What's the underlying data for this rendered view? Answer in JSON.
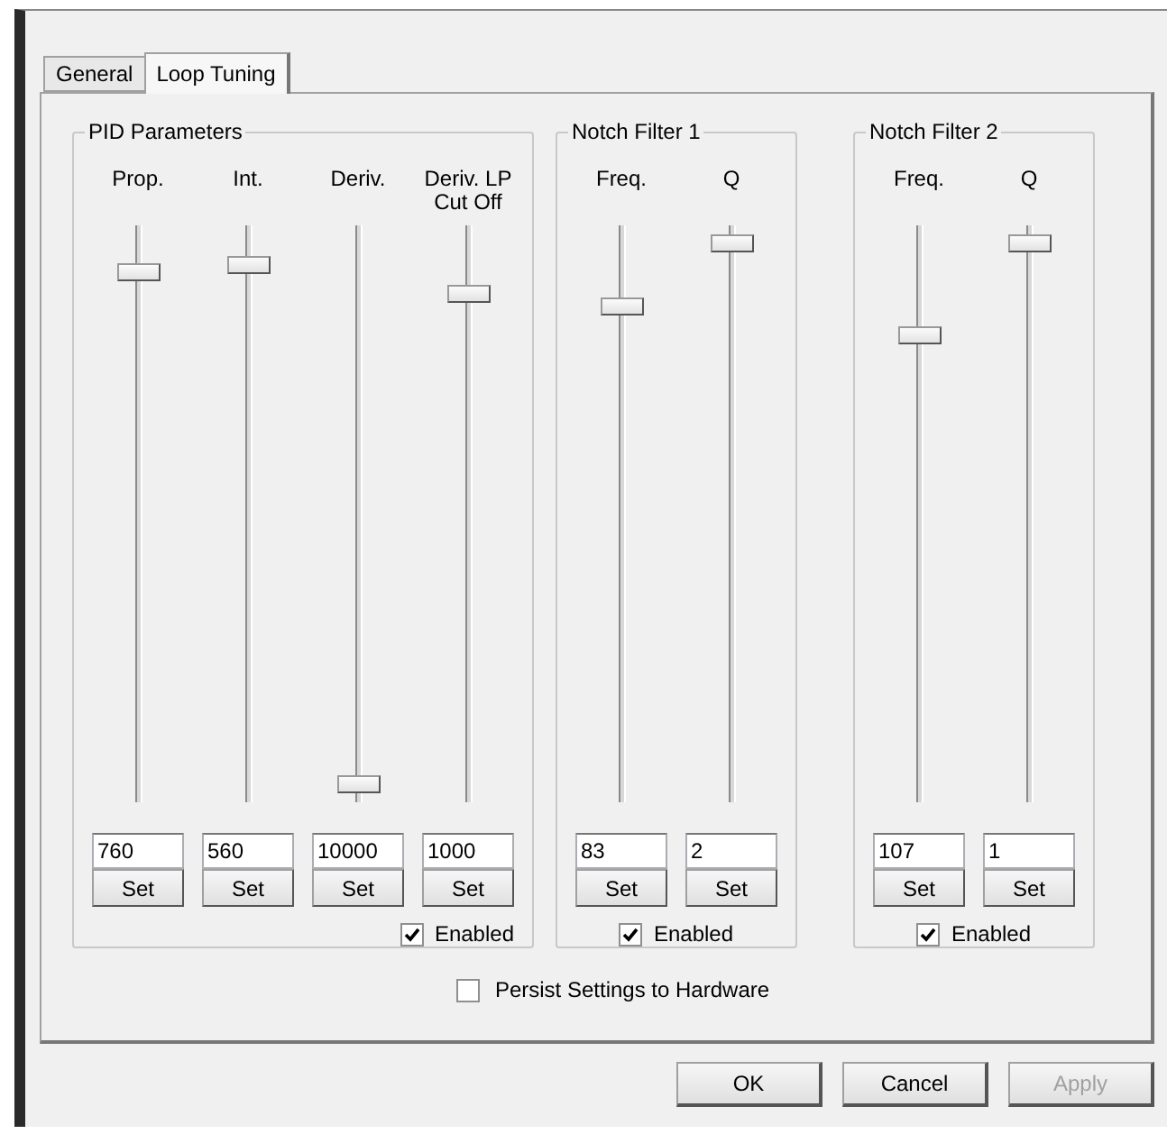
{
  "tabs": [
    {
      "label": "General",
      "selected": false
    },
    {
      "label": "Loop Tuning",
      "selected": true
    }
  ],
  "groups": [
    {
      "title": "PID Parameters",
      "channels": [
        {
          "label": "Prop.",
          "level": 0.92,
          "value": "760",
          "button": "Set"
        },
        {
          "label": "Int.",
          "level": 0.93,
          "value": "560",
          "button": "Set"
        },
        {
          "label": "Deriv.",
          "level": 0.03,
          "value": "10000",
          "button": "Set"
        },
        {
          "label": "Deriv. LP Cut Off",
          "level": 0.88,
          "value": "1000",
          "button": "Set"
        }
      ],
      "enable": {
        "label": "Enabled",
        "checked": true
      }
    },
    {
      "title": "Notch Filter 1",
      "channels": [
        {
          "label": "Freq.",
          "level": 0.86,
          "value": "83",
          "button": "Set"
        },
        {
          "label": "Q",
          "level": 0.97,
          "value": "2",
          "button": "Set"
        }
      ],
      "enable": {
        "label": "Enabled",
        "checked": true
      }
    },
    {
      "title": "Notch Filter 2",
      "channels": [
        {
          "label": "Freq.",
          "level": 0.81,
          "value": "107",
          "button": "Set"
        },
        {
          "label": "Q",
          "level": 0.97,
          "value": "1",
          "button": "Set"
        }
      ],
      "enable": {
        "label": "Enabled",
        "checked": true
      }
    }
  ],
  "persist": {
    "label": "Persist Settings to Hardware",
    "checked": false
  },
  "buttons": [
    {
      "label": "OK",
      "disabled": false
    },
    {
      "label": "Cancel",
      "disabled": false
    },
    {
      "label": "Apply",
      "disabled": true
    }
  ]
}
